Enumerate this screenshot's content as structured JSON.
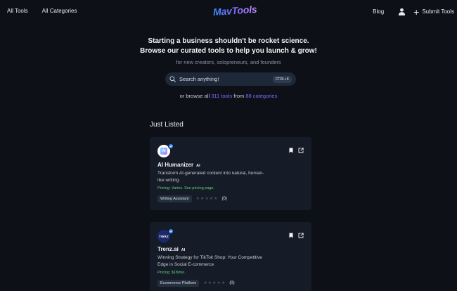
{
  "header": {
    "nav_left": [
      "All Tools",
      "All Categories"
    ],
    "logo": "MavTools",
    "blog": "Blog",
    "submit": "Submit Tools"
  },
  "hero": {
    "title_line1": "Starting a business shouldn't be rocket science.",
    "title_line2": "Browse our curated tools to help you launch & grow!",
    "subtitle": "for new creators, solopreneurs, and founders",
    "search_placeholder": "Search anything!",
    "shortcut": "CTRL+K",
    "browse_prefix": "or browse all",
    "tools_count": "311 tools",
    "browse_mid": "from",
    "categories_count": "88 categories"
  },
  "section": {
    "title": "Just Listed"
  },
  "cards": [
    {
      "logo_text": "AI",
      "name": "AI Humanizer",
      "badge": "AI",
      "desc": "Transform AI-generated content into natural, human-like writing.",
      "pricing": "Pricing: Varies. See pricing page.",
      "tag": "Writing Assistant",
      "rating_count": "(0)"
    },
    {
      "logo_text": "TWRZ",
      "name": "Trenz.ai",
      "badge": "AI",
      "desc": "Winning Strategy for TikTok Shop: Your Competitive Edge in Social E-commerce",
      "pricing": "Pricing: $18/mo.",
      "tag": "Ecommerce Platform",
      "rating_count": "(0)"
    }
  ],
  "colors": {
    "background": "#0d1016",
    "card": "#151c27",
    "accent": "#7c6dff",
    "pricing": "#5fd47c",
    "verified": "#3c8cff"
  }
}
